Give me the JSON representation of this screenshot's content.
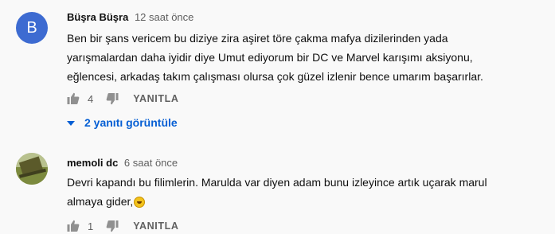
{
  "comments": [
    {
      "avatar_letter": "B",
      "author": "Büşra Büşra",
      "time": "12 saat önce",
      "lines": [
        "Ben bir şans vericem bu diziye zira aşiret töre çakma mafya dizilerinden yada",
        "yarışmalardan daha iyidir diye Umut ediyorum bir DC ve Marvel karışımı aksiyonu,",
        "eğlencesi, arkadaş takım çalışması olursa çok güzel izlenir bence umarım başarırlar."
      ],
      "likes": "4",
      "reply_label": "YANITLA",
      "replies_toggle": "2 yanıtı görüntüle"
    },
    {
      "author": "memoli dc",
      "time": "6 saat önce",
      "lines": [
        "Devri kapandı bu filimlerin. Marulda var diyen adam bunu izleyince artık uçarak marul",
        "almaya gider,"
      ],
      "likes": "1",
      "reply_label": "YANITLA"
    }
  ],
  "colors": {
    "link": "#065fd4",
    "avatar_bg": "#3d6bd1",
    "muted": "#606060"
  },
  "icons": [
    "thumbs-up-icon",
    "thumbs-down-icon",
    "chevron-down-icon",
    "laughing-emoji-icon"
  ]
}
